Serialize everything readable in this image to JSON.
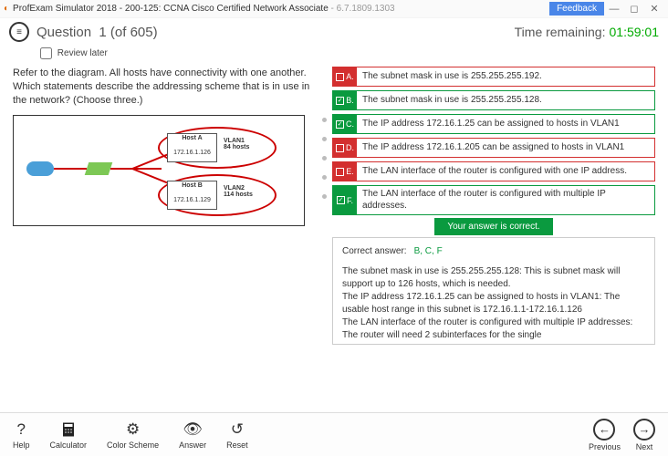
{
  "titlebar": {
    "app": "ProfExam Simulator 2018",
    "exam": "200-125: CCNA Cisco Certified Network Associate",
    "ver": "6.7.1809.1303",
    "feedback": "Feedback"
  },
  "header": {
    "q_label": "Question",
    "q_num": "1",
    "q_total": "(of 605)",
    "time_label": "Time remaining:",
    "time_val": "01:59:01"
  },
  "review_label": "Review later",
  "question_text": "Refer to the diagram. All hosts have connectivity with one another. Which statements describe the addressing scheme that is in use in the network? (Choose three.)",
  "diagram": {
    "hostA": {
      "title": "Host A",
      "ip": "172.16.1.126"
    },
    "hostB": {
      "title": "Host B",
      "ip": "172.16.1.129"
    },
    "vlan1": {
      "name": "VLAN1",
      "hosts": "84 hosts"
    },
    "vlan2": {
      "name": "VLAN2",
      "hosts": "114 hosts"
    }
  },
  "options": [
    {
      "letter": "A.",
      "text": "The subnet mask in use is 255.255.255.192.",
      "checked": false,
      "state": "red"
    },
    {
      "letter": "B.",
      "text": "The subnet mask in use is 255.255.255.128.",
      "checked": true,
      "state": "green"
    },
    {
      "letter": "C.",
      "text": "The IP address 172.16.1.25 can be assigned to hosts in VLAN1",
      "checked": true,
      "state": "green"
    },
    {
      "letter": "D.",
      "text": "The IP address 172.16.1.205 can be assigned to hosts in VLAN1",
      "checked": false,
      "state": "red"
    },
    {
      "letter": "E.",
      "text": "The LAN interface of the router is configured with one IP address.",
      "checked": false,
      "state": "red"
    },
    {
      "letter": "F.",
      "text": "The LAN interface of the router is configured with multiple IP addresses.",
      "checked": true,
      "state": "green"
    }
  ],
  "result_banner": "Your answer is correct.",
  "correct_label": "Correct answer:",
  "correct_letters": "B, C, F",
  "explanation": "The subnet mask in use is 255.255.255.128: This is subnet mask will support up to 126 hosts, which is needed.\nThe IP address 172.16.1.25 can be assigned to hosts in VLAN1: The usable host range in this subnet is 172.16.1.1-172.16.1.126\nThe LAN interface of the router is configured with multiple IP addresses: The router will need 2 subinterfaces for the single",
  "footer": {
    "help": "Help",
    "calc": "Calculator",
    "color": "Color Scheme",
    "answer": "Answer",
    "reset": "Reset",
    "prev": "Previous",
    "next": "Next"
  }
}
